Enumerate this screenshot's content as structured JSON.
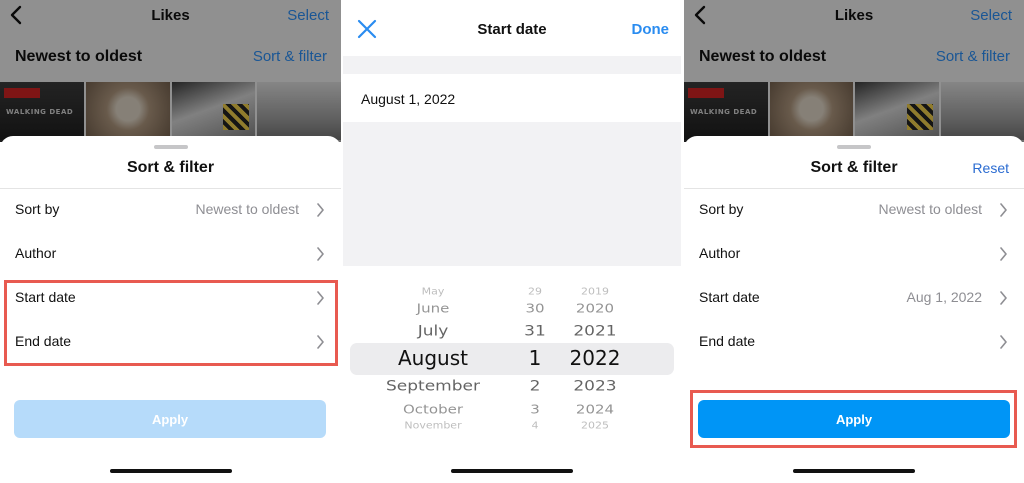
{
  "panel1": {
    "background": {
      "title": "Likes",
      "select": "Select",
      "sort_order": "Newest to oldest",
      "sort_filter": "Sort & filter",
      "thumbnail_text": "WALKING DEAD"
    },
    "sheet": {
      "title": "Sort & filter",
      "rows": [
        {
          "label": "Sort by",
          "value": "Newest to oldest"
        },
        {
          "label": "Author",
          "value": ""
        },
        {
          "label": "Start date",
          "value": ""
        },
        {
          "label": "End date",
          "value": ""
        }
      ],
      "apply": "Apply",
      "apply_state": "disabled",
      "highlight": "Start date and End date rows"
    }
  },
  "panel2": {
    "title": "Start date",
    "done": "Done",
    "date_value": "August 1, 2022",
    "picker": {
      "months": [
        "May",
        "June",
        "July",
        "August",
        "September",
        "October",
        "November"
      ],
      "days": [
        "29",
        "30",
        "31",
        "1",
        "2",
        "3",
        "4"
      ],
      "years": [
        "2019",
        "2020",
        "2021",
        "2022",
        "2023",
        "2024",
        "2025"
      ],
      "selected": {
        "month": "August",
        "day": "1",
        "year": "2022"
      }
    }
  },
  "panel3": {
    "background": {
      "title": "Likes",
      "select": "Select",
      "sort_order": "Newest to oldest",
      "sort_filter": "Sort & filter",
      "thumbnail_text": "WALKING DEAD"
    },
    "sheet": {
      "title": "Sort & filter",
      "reset": "Reset",
      "rows": [
        {
          "label": "Sort by",
          "value": "Newest to oldest"
        },
        {
          "label": "Author",
          "value": ""
        },
        {
          "label": "Start date",
          "value": "Aug 1, 2022"
        },
        {
          "label": "End date",
          "value": ""
        }
      ],
      "apply": "Apply",
      "apply_state": "enabled",
      "highlight": "Apply button"
    }
  },
  "colors": {
    "accent_blue": "#0095f6",
    "link_blue": "#2a8cf0",
    "disabled_blue": "#b6dbfa",
    "highlight_red": "#e85a50"
  },
  "icons": [
    "back-chevron-icon",
    "chevron-right-icon",
    "close-icon"
  ]
}
